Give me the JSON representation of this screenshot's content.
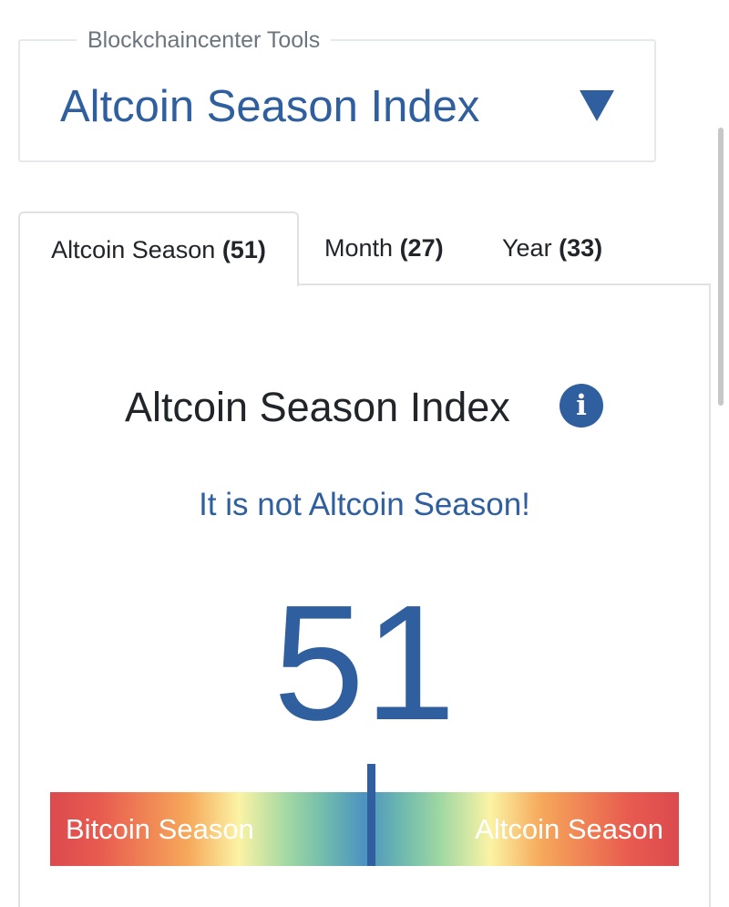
{
  "tools": {
    "legend": "Blockchaincenter Tools",
    "selected": "Altcoin Season Index"
  },
  "tabs": [
    {
      "label": "Altcoin Season",
      "count": "(51)",
      "active": true
    },
    {
      "label": "Month",
      "count": "(27)",
      "active": false
    },
    {
      "label": "Year",
      "count": "(33)",
      "active": false
    }
  ],
  "panel": {
    "title": "Altcoin Season Index",
    "info_icon": "i",
    "status": "It is not Altcoin Season!",
    "value": "51"
  },
  "gauge": {
    "left_label": "Bitcoin Season",
    "right_label": "Altcoin Season",
    "min": 0,
    "max": 100,
    "value": 51
  },
  "colors": {
    "accent": "#2f5f9e",
    "text": "#212529",
    "muted": "#6c757d",
    "border": "#dee2e6"
  },
  "icons": {
    "dropdown": "caret-down-icon",
    "info": "info-circle-icon"
  }
}
